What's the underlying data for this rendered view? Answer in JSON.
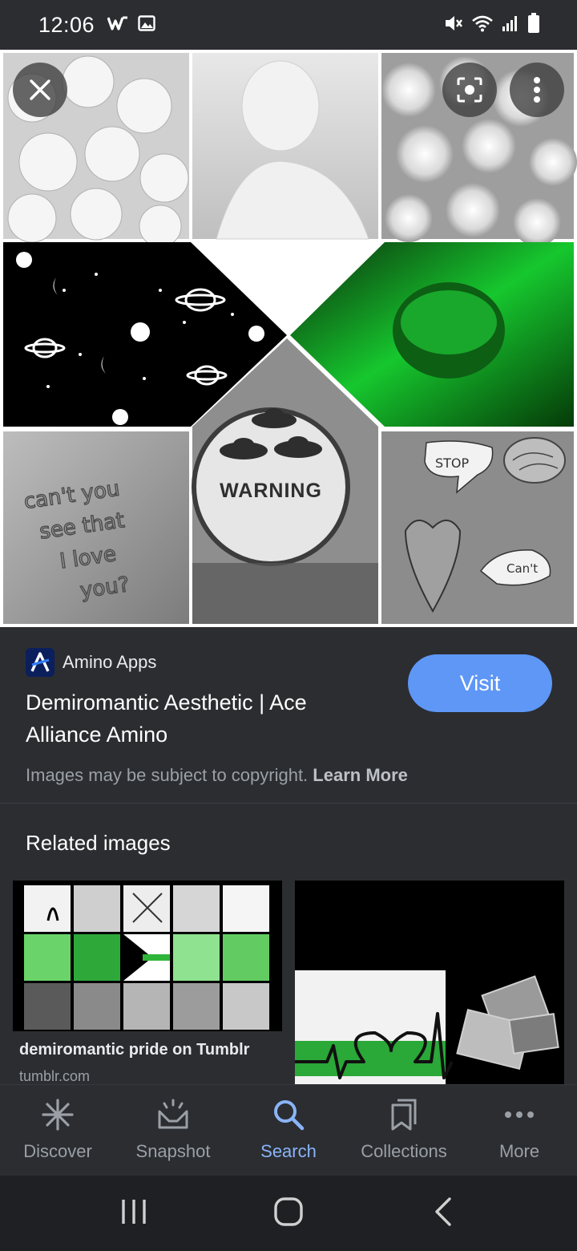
{
  "status_bar": {
    "time": "12:06",
    "icons": [
      "w-app-icon",
      "image-icon",
      "mute-icon",
      "wifi-icon",
      "signal-icon",
      "battery-icon"
    ]
  },
  "viewer": {
    "collage_text_1": "can't you see that I love you?",
    "collage_text_2": "WARNING",
    "collage_text_3": "STOP",
    "collage_text_4": "Can't"
  },
  "result": {
    "source_name": "Amino Apps",
    "title": "Demiromantic Aesthetic | Ace Alliance Amino",
    "visit_label": "Visit",
    "copyright_text": "Images may be subject to copyright.",
    "learn_more": "Learn More"
  },
  "related": {
    "heading": "Related images",
    "cards": [
      {
        "title": "demiromantic pride on Tumblr",
        "domain": "tumblr.com"
      },
      {
        "title": "",
        "domain": ""
      }
    ]
  },
  "bottom_nav": {
    "items": [
      {
        "label": "Discover",
        "icon": "asterisk-icon"
      },
      {
        "label": "Snapshot",
        "icon": "snapshot-icon"
      },
      {
        "label": "Search",
        "icon": "search-icon"
      },
      {
        "label": "Collections",
        "icon": "collections-icon"
      },
      {
        "label": "More",
        "icon": "more-dots-icon"
      }
    ],
    "active": "Search"
  },
  "colors": {
    "background": "#2b2d31",
    "accent": "#5e97f6",
    "active_nav": "#8ab4f8",
    "green": "#16c72e"
  }
}
